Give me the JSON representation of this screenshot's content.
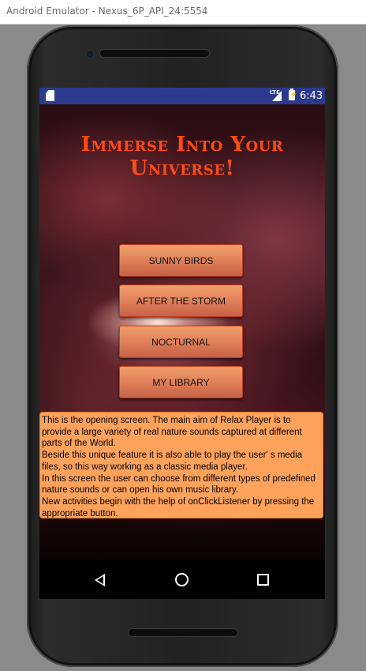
{
  "window": {
    "title": "Android Emulator - Nexus_6P_API_24:5554"
  },
  "status_bar": {
    "network": "LTE",
    "battery": "⚡",
    "time": "6:43",
    "icons": [
      "sd-card-icon",
      "signal-icon",
      "battery-charging-icon"
    ]
  },
  "app": {
    "heading_line1": "Immerse Into Your",
    "heading_line2": "Universe!",
    "buttons": [
      {
        "label": "SUNNY BIRDS"
      },
      {
        "label": "AFTER THE STORM"
      },
      {
        "label": "NOCTURNAL"
      },
      {
        "label": "MY LIBRARY"
      }
    ],
    "info_paragraphs": [
      "This is the opening screen. The main aim of Relax Player is to provide a large variety of real nature sounds captured at different parts of the World.",
      " Beside this unique feature it is also able to play the user' s media files, so this way working as a classic media player.",
      " In this screen the user can choose from different types of predefined nature sounds or can open his own music library.",
      " New activities begin with the help of onClickListener by pressing the appropriate button."
    ]
  },
  "nav_bar": {
    "icons": [
      "back-icon",
      "home-icon",
      "recents-icon"
    ]
  },
  "colors": {
    "heading": "#ff4b16",
    "button_fill": "#e0805a",
    "button_border": "#c23a1c",
    "info_fill": "#ffa25c",
    "status_bar": "#2c3a8e"
  }
}
